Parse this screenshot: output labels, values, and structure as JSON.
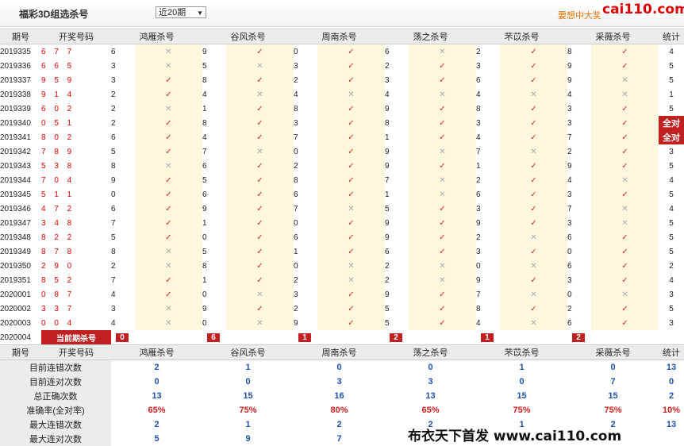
{
  "header": {
    "title": "福彩3D组选杀号",
    "period_select": "近20期",
    "promo": "要想中大奖",
    "logo": "cai110.com"
  },
  "columns": {
    "period": "期号",
    "numbers": "开奖号码",
    "experts": [
      "鸿雁杀号",
      "谷风杀号",
      "周南杀号",
      "荡之杀号",
      "芣苡杀号",
      "采薇杀号"
    ],
    "count": "统计"
  },
  "rows": [
    {
      "period": "2019335",
      "numbers": "6 7 7",
      "kills": [
        [
          "6",
          "no"
        ],
        [
          "9",
          "ok"
        ],
        [
          "0",
          "ok"
        ],
        [
          "6",
          "no"
        ],
        [
          "2",
          "ok"
        ],
        [
          "8",
          "ok"
        ]
      ],
      "count": "4"
    },
    {
      "period": "2019336",
      "numbers": "6 6 5",
      "kills": [
        [
          "3",
          "no"
        ],
        [
          "5",
          "no"
        ],
        [
          "3",
          "ok"
        ],
        [
          "2",
          "ok"
        ],
        [
          "3",
          "ok"
        ],
        [
          "9",
          "ok"
        ]
      ],
      "count": "5"
    },
    {
      "period": "2019337",
      "numbers": "9 5 9",
      "kills": [
        [
          "3",
          "ok"
        ],
        [
          "8",
          "ok"
        ],
        [
          "2",
          "ok"
        ],
        [
          "3",
          "ok"
        ],
        [
          "6",
          "ok"
        ],
        [
          "9",
          "no"
        ]
      ],
      "count": "5"
    },
    {
      "period": "2019338",
      "numbers": "9 1 4",
      "kills": [
        [
          "2",
          "ok"
        ],
        [
          "4",
          "no"
        ],
        [
          "4",
          "no"
        ],
        [
          "4",
          "no"
        ],
        [
          "4",
          "no"
        ],
        [
          "4",
          "no"
        ]
      ],
      "count": "1"
    },
    {
      "period": "2019339",
      "numbers": "6 0 2",
      "kills": [
        [
          "2",
          "no"
        ],
        [
          "1",
          "ok"
        ],
        [
          "8",
          "ok"
        ],
        [
          "9",
          "ok"
        ],
        [
          "8",
          "ok"
        ],
        [
          "3",
          "ok"
        ]
      ],
      "count": "5"
    },
    {
      "period": "2019340",
      "numbers": "0 5 1",
      "kills": [
        [
          "2",
          "ok"
        ],
        [
          "8",
          "ok"
        ],
        [
          "3",
          "ok"
        ],
        [
          "8",
          "ok"
        ],
        [
          "3",
          "ok"
        ],
        [
          "3",
          "ok"
        ]
      ],
      "count": "全对"
    },
    {
      "period": "2019341",
      "numbers": "8 0 2",
      "kills": [
        [
          "6",
          "ok"
        ],
        [
          "4",
          "ok"
        ],
        [
          "7",
          "ok"
        ],
        [
          "1",
          "ok"
        ],
        [
          "4",
          "ok"
        ],
        [
          "7",
          "ok"
        ]
      ],
      "count": "全对"
    },
    {
      "period": "2019342",
      "numbers": "7 8 9",
      "kills": [
        [
          "5",
          "ok"
        ],
        [
          "7",
          "no"
        ],
        [
          "0",
          "ok"
        ],
        [
          "9",
          "no"
        ],
        [
          "7",
          "no"
        ],
        [
          "2",
          "ok"
        ]
      ],
      "count": "3"
    },
    {
      "period": "2019343",
      "numbers": "5 3 8",
      "kills": [
        [
          "8",
          "no"
        ],
        [
          "6",
          "ok"
        ],
        [
          "2",
          "ok"
        ],
        [
          "9",
          "ok"
        ],
        [
          "1",
          "ok"
        ],
        [
          "9",
          "ok"
        ]
      ],
      "count": "5"
    },
    {
      "period": "2019344",
      "numbers": "7 0 4",
      "kills": [
        [
          "9",
          "ok"
        ],
        [
          "5",
          "ok"
        ],
        [
          "8",
          "ok"
        ],
        [
          "7",
          "no"
        ],
        [
          "2",
          "ok"
        ],
        [
          "4",
          "no"
        ]
      ],
      "count": "4"
    },
    {
      "period": "2019345",
      "numbers": "5 1 1",
      "kills": [
        [
          "0",
          "ok"
        ],
        [
          "6",
          "ok"
        ],
        [
          "6",
          "ok"
        ],
        [
          "1",
          "no"
        ],
        [
          "6",
          "ok"
        ],
        [
          "3",
          "ok"
        ]
      ],
      "count": "5"
    },
    {
      "period": "2019346",
      "numbers": "4 7 2",
      "kills": [
        [
          "6",
          "ok"
        ],
        [
          "9",
          "ok"
        ],
        [
          "7",
          "no"
        ],
        [
          "5",
          "ok"
        ],
        [
          "3",
          "ok"
        ],
        [
          "7",
          "no"
        ]
      ],
      "count": "4"
    },
    {
      "period": "2019347",
      "numbers": "3 4 8",
      "kills": [
        [
          "7",
          "ok"
        ],
        [
          "1",
          "ok"
        ],
        [
          "0",
          "ok"
        ],
        [
          "9",
          "ok"
        ],
        [
          "9",
          "ok"
        ],
        [
          "3",
          "no"
        ]
      ],
      "count": "5"
    },
    {
      "period": "2019348",
      "numbers": "8 2 2",
      "kills": [
        [
          "5",
          "ok"
        ],
        [
          "0",
          "ok"
        ],
        [
          "6",
          "ok"
        ],
        [
          "9",
          "ok"
        ],
        [
          "2",
          "no"
        ],
        [
          "6",
          "ok"
        ]
      ],
      "count": "5"
    },
    {
      "period": "2019349",
      "numbers": "8 7 8",
      "kills": [
        [
          "8",
          "no"
        ],
        [
          "5",
          "ok"
        ],
        [
          "1",
          "ok"
        ],
        [
          "6",
          "ok"
        ],
        [
          "3",
          "ok"
        ],
        [
          "0",
          "ok"
        ]
      ],
      "count": "5"
    },
    {
      "period": "2019350",
      "numbers": "2 9 0",
      "kills": [
        [
          "2",
          "no"
        ],
        [
          "8",
          "ok"
        ],
        [
          "0",
          "no"
        ],
        [
          "2",
          "no"
        ],
        [
          "0",
          "no"
        ],
        [
          "6",
          "ok"
        ]
      ],
      "count": "2"
    },
    {
      "period": "2019351",
      "numbers": "8 5 2",
      "kills": [
        [
          "7",
          "ok"
        ],
        [
          "1",
          "ok"
        ],
        [
          "2",
          "no"
        ],
        [
          "2",
          "no"
        ],
        [
          "9",
          "ok"
        ],
        [
          "3",
          "ok"
        ]
      ],
      "count": "4"
    },
    {
      "period": "2020001",
      "numbers": "0 8 7",
      "kills": [
        [
          "4",
          "ok"
        ],
        [
          "0",
          "no"
        ],
        [
          "3",
          "ok"
        ],
        [
          "9",
          "ok"
        ],
        [
          "7",
          "no"
        ],
        [
          "0",
          "no"
        ]
      ],
      "count": "3"
    },
    {
      "period": "2020002",
      "numbers": "3 3 7",
      "kills": [
        [
          "3",
          "no"
        ],
        [
          "9",
          "ok"
        ],
        [
          "2",
          "ok"
        ],
        [
          "5",
          "ok"
        ],
        [
          "8",
          "ok"
        ],
        [
          "2",
          "ok"
        ]
      ],
      "count": "5"
    },
    {
      "period": "2020003",
      "numbers": "0 0 4",
      "kills": [
        [
          "4",
          "no"
        ],
        [
          "0",
          "no"
        ],
        [
          "9",
          "ok"
        ],
        [
          "5",
          "ok"
        ],
        [
          "4",
          "no"
        ],
        [
          "6",
          "ok"
        ]
      ],
      "count": "3"
    }
  ],
  "current": {
    "period": "2020004",
    "label": "当前期杀号",
    "kills": [
      "0",
      "6",
      "1",
      "2",
      "1",
      "2"
    ]
  },
  "stats": {
    "header": {
      "period": "期号",
      "numbers": "开奖号码",
      "experts": [
        "鸿雁杀号",
        "谷风杀号",
        "周南杀号",
        "荡之杀号",
        "芣苡杀号",
        "采薇杀号"
      ],
      "count": "统计"
    },
    "rows": [
      {
        "label": "目前连错次数",
        "values": [
          "2",
          "1",
          "0",
          "0",
          "1",
          "0"
        ],
        "count": "13",
        "rate": false
      },
      {
        "label": "目前连对次数",
        "values": [
          "0",
          "0",
          "3",
          "3",
          "0",
          "7"
        ],
        "count": "0",
        "rate": false
      },
      {
        "label": "总正确次数",
        "values": [
          "13",
          "15",
          "16",
          "13",
          "15",
          "15"
        ],
        "count": "2",
        "rate": false
      },
      {
        "label": "准确率(全对率)",
        "values": [
          "65%",
          "75%",
          "80%",
          "65%",
          "75%",
          "75%"
        ],
        "count": "10%",
        "rate": true
      },
      {
        "label": "最大连错次数",
        "values": [
          "2",
          "1",
          "2",
          "2",
          "1",
          "2"
        ],
        "count": "13",
        "rate": false
      },
      {
        "label": "最大连对次数",
        "values": [
          "5",
          "9",
          "7",
          "",
          "",
          ""
        ],
        "count": "",
        "rate": false
      }
    ]
  },
  "watermark": "布衣天下首发 www.cai110.com",
  "colors": {
    "accent_red": "#c02020",
    "check_red": "#e02020",
    "stat_blue": "#1e50b4",
    "cell_cream": "#fdf7dd"
  },
  "icons": {
    "correct": "check-icon",
    "wrong": "cross-icon"
  }
}
